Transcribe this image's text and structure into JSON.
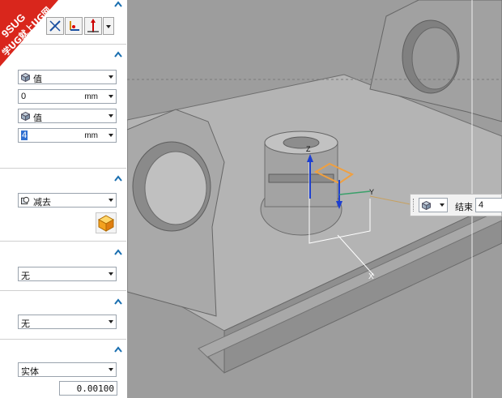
{
  "watermark": {
    "line1": "9SUG",
    "line2": "学UG就上UG网"
  },
  "panel": {
    "sec1": {
      "combo1": {
        "value": "值",
        "icon": "cube-icon"
      },
      "distance": {
        "value": "0",
        "unit": "mm"
      },
      "combo2": {
        "value": "值",
        "icon": "cube-icon"
      },
      "end": {
        "value": "4",
        "unit": "mm"
      }
    },
    "sec2": {
      "boolean": {
        "value": "减去",
        "icon": "subtract-icon"
      }
    },
    "sec3": {
      "combo": {
        "value": "无"
      }
    },
    "sec4": {
      "combo": {
        "value": "无"
      }
    },
    "sec5": {
      "combo": {
        "value": "实体"
      },
      "tolerance": "0.00100"
    }
  },
  "viewport": {
    "axis_labels": {
      "z": "Z",
      "y": "Y",
      "x": "X"
    },
    "float_bar": {
      "label": "结束",
      "value": "4"
    }
  },
  "colors": {
    "accent": "#1a6fb0",
    "selection": "#2f6fd1",
    "handle": "#f0a040"
  }
}
